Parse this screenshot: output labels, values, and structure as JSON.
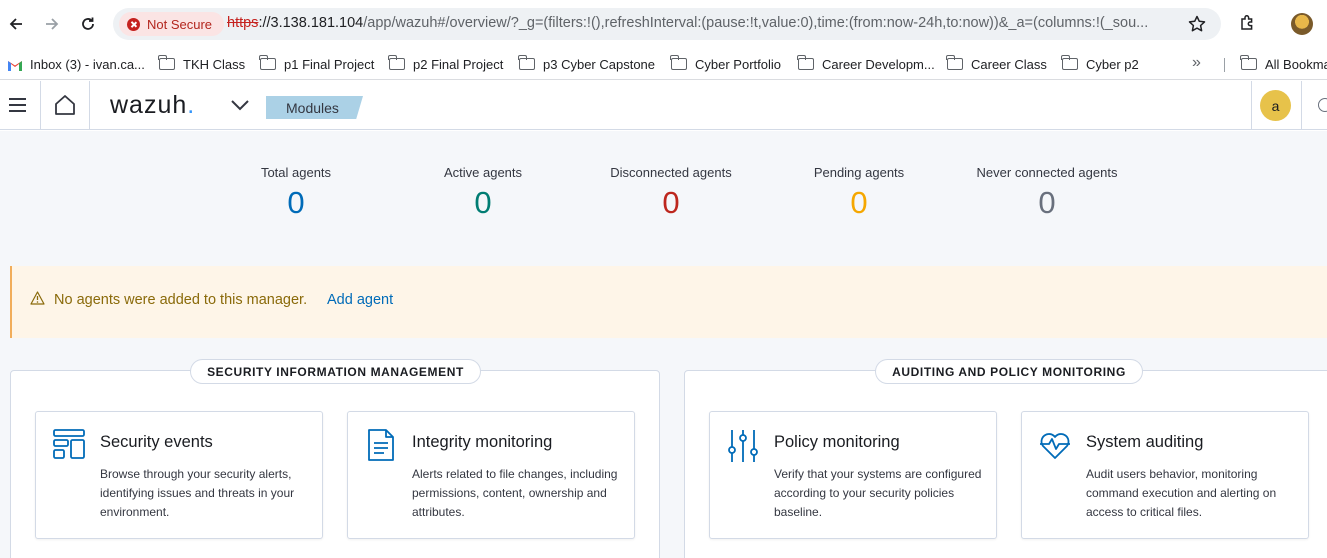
{
  "browser": {
    "security_label": "Not Secure",
    "url_scheme": "https",
    "url_host": "://3.138.181.104",
    "url_rest": "/app/wazuh#/overview/?_g=(filters:!(),refreshInterval:(pause:!t,value:0),time:(from:now-24h,to:now))&_a=(columns:!(_sou..."
  },
  "bookmarks": [
    {
      "label": "Inbox (3) - ivan.ca...",
      "icon": "gmail-icon"
    },
    {
      "label": "TKH Class",
      "icon": "folder-icon"
    },
    {
      "label": "p1 Final Project",
      "icon": "folder-icon"
    },
    {
      "label": "p2 Final Project",
      "icon": "folder-icon"
    },
    {
      "label": "p3 Cyber Capstone",
      "icon": "folder-icon"
    },
    {
      "label": "Cyber Portfolio",
      "icon": "folder-icon"
    },
    {
      "label": "Career Developm...",
      "icon": "folder-icon"
    },
    {
      "label": "Career Class",
      "icon": "folder-icon"
    },
    {
      "label": "Cyber p2",
      "icon": "folder-icon"
    },
    {
      "label": "All Bookmarks",
      "icon": "folder-icon"
    }
  ],
  "header": {
    "logo": "wazuh",
    "logo_dot": ".",
    "breadcrumb": "Modules",
    "avatar_initial": "a"
  },
  "stats": [
    {
      "label": "Total agents",
      "value": "0",
      "color": "#006bb8"
    },
    {
      "label": "Active agents",
      "value": "0",
      "color": "#017d73"
    },
    {
      "label": "Disconnected agents",
      "value": "0",
      "color": "#bd271e"
    },
    {
      "label": "Pending agents",
      "value": "0",
      "color": "#f5a700"
    },
    {
      "label": "Never connected agents",
      "value": "0",
      "color": "#69707d"
    }
  ],
  "callout": {
    "message": "No agents were added to this manager.",
    "link": "Add agent"
  },
  "panels": [
    {
      "title": "SECURITY INFORMATION MANAGEMENT",
      "cards": [
        {
          "title": "Security events",
          "description": "Browse through your security alerts, identifying issues and threats in your environment.",
          "icon": "dashboard-icon"
        },
        {
          "title": "Integrity monitoring",
          "description": "Alerts related to file changes, including permissions, content, ownership and attributes.",
          "icon": "document-icon"
        }
      ]
    },
    {
      "title": "AUDITING AND POLICY MONITORING",
      "cards": [
        {
          "title": "Policy monitoring",
          "description": "Verify that your systems are configured according to your security policies baseline.",
          "icon": "sliders-icon"
        },
        {
          "title": "System auditing",
          "description": "Audit users behavior, monitoring command execution and alerting on access to critical files.",
          "icon": "heartbeat-icon"
        }
      ]
    }
  ]
}
